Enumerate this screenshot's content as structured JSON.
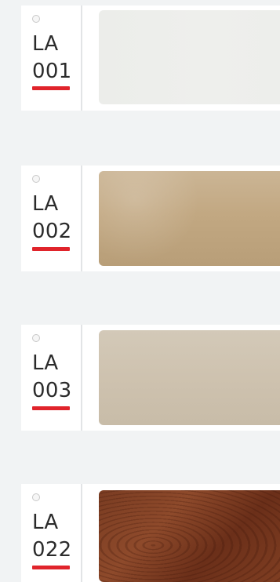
{
  "swatches": [
    {
      "prefix": "LA",
      "number": "001",
      "finish": "white-plain",
      "color": "#edeeeb",
      "accent": "#e0242b"
    },
    {
      "prefix": "LA",
      "number": "002",
      "finish": "gold-metallic",
      "color": "#c2a882",
      "accent": "#e0242b"
    },
    {
      "prefix": "LA",
      "number": "003",
      "finish": "beige-plain",
      "color": "#cec2af",
      "accent": "#e0242b"
    },
    {
      "prefix": "LA",
      "number": "022",
      "finish": "walnut-wood",
      "color": "#7a3c22",
      "accent": "#e0242b"
    }
  ]
}
